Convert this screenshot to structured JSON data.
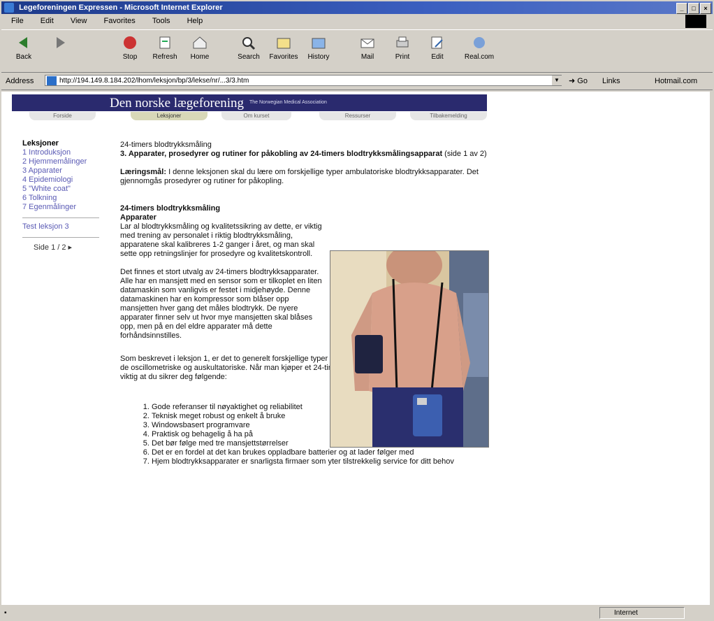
{
  "window": {
    "title": "Legeforeningen Expressen - Microsoft Internet Explorer"
  },
  "menu": [
    "File",
    "Edit",
    "View",
    "Favorites",
    "Tools",
    "Help"
  ],
  "toolbar": [
    {
      "label": "Back",
      "icon": "back-icon"
    },
    {
      "label": "",
      "icon": "forward-icon"
    },
    {
      "label": "Stop",
      "icon": "stop-icon"
    },
    {
      "label": "Refresh",
      "icon": "refresh-icon"
    },
    {
      "label": "Home",
      "icon": "home-icon"
    },
    {
      "label": "Search",
      "icon": "search-icon"
    },
    {
      "label": "Favorites",
      "icon": "favorites-icon"
    },
    {
      "label": "History",
      "icon": "history-icon"
    },
    {
      "label": "Mail",
      "icon": "mail-icon"
    },
    {
      "label": "Print",
      "icon": "print-icon"
    },
    {
      "label": "Edit",
      "icon": "edit-icon"
    },
    {
      "label": "Real.com",
      "icon": "realcom-icon"
    }
  ],
  "address": {
    "label": "Address",
    "url": "http://194.149.8.184.202/lhom/leksjon/bp/3/lekse/nr/...3/3.htm",
    "go": "Go",
    "links": "Links",
    "hotmail": "Hotmail.com"
  },
  "status": {
    "zone": "Internet"
  },
  "page": {
    "banner": {
      "name": "Den norske lægeforening",
      "sub": "The Norwegian Medical Association"
    },
    "tabs": [
      "Forside",
      "Leksjoner",
      "Om kurset",
      "Ressurser",
      "Tilbakemelding"
    ],
    "sidebar": {
      "heading": "Leksjoner",
      "items": [
        "1 Introduksjon",
        "2 Hjemmemålinger",
        "3 Apparater",
        "4 Epidemiologi",
        "5 \"White coat\"",
        "6 Tolkning",
        "7 Egenmålinger"
      ],
      "test": "Test leksjon 3",
      "pager": "Side 1 / 2 ▸"
    },
    "content": {
      "kicker": "24-timers blodtrykksmåling",
      "heading": "3. Apparater, prosedyrer og rutiner for påkobling av 24-timers blodtrykksmålingsapparat",
      "heading_suffix": " (side 1 av 2)",
      "goal_label": "Læringsmål:",
      "goal_text": " I denne leksjonen skal du lære om forskjellige typer ambulatoriske blodtrykksapparater. Det gjennomgås prosedyrer og rutiner for påkopling.",
      "section_title": "24-timers blodtrykksmåling",
      "sub_title": "Apparater",
      "p1": "Lar al blodtrykksmåling og kvalitetssikring av dette, er viktig med trening av personalet i riktig blodtrykksmåling, apparatene skal kalibreres 1-2 ganger i året, og man skal sette opp retningslinjer for prosedyre og kvalitetskontroll.",
      "p2": "Det finnes et stort utvalg av 24-timers blodtrykksapparater. Alle har en mansjett med en sensor som er tilkoplet en liten datamaskin som vanligvis er festet i midjehøyde. Denne datamaskinen har en kompressor som blåser opp mansjetten hver gang det måles blodtrykk. De nyere apparater finner selv ut hvor mye mansjetten skal blåses opp, men på en del eldre apparater må dette forhåndsinnstilles.",
      "p3": "Som beskrevet i leksjon 1, er det to generelt forskjellige typer 24-timers ambulatoriske blodtrykksapparater, de oscillometriske og auskultatoriske. Når man kjøper et 24-timers ambulatorisk blodtrykksapparat er det viktig at du sikrer deg følgende:",
      "list": [
        "Gode referanser til nøyaktighet og reliabilitet",
        "Teknisk meget robust og enkelt å bruke",
        "Windowsbasert programvare",
        "Praktisk og behagelig å ha på",
        "Det bør følge med tre mansjettstørrelser",
        "Det er en fordel at det kan brukes oppladbare batterier og at lader følger med",
        "Hjem blodtrykksapparater er snarligsta firmaer som yter tilstrekkelig service for ditt behov"
      ]
    }
  }
}
